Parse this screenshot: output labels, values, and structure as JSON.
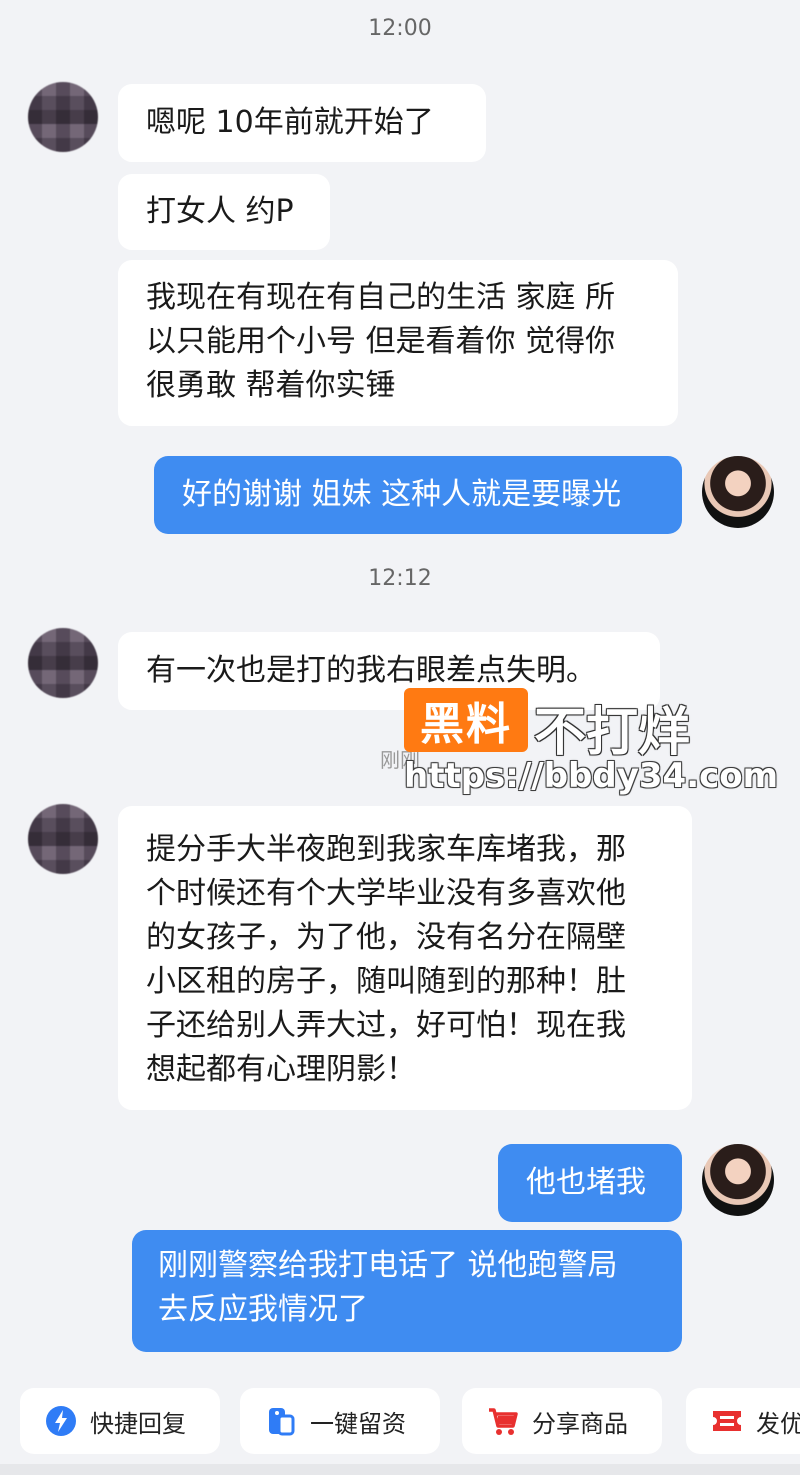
{
  "timestamps": [
    "12:00",
    "12:12",
    "刚刚"
  ],
  "messages": [
    {
      "side": "in",
      "text": "嗯呢 10年前就开始了"
    },
    {
      "side": "in",
      "text": "打女人 约P"
    },
    {
      "side": "in",
      "lines": [
        "我现在有现在有自己的生活 家庭 所",
        "以只能用个小号 但是看着你 觉得你",
        "很勇敢 帮着你实锤"
      ]
    },
    {
      "side": "out",
      "text": "好的谢谢 姐妹 这种人就是要曝光"
    },
    {
      "side": "in",
      "text": "有一次也是打的我右眼差点失明。"
    },
    {
      "side": "in",
      "lines": [
        "提分手大半夜跑到我家车库堵我，那",
        "个时候还有个大学毕业没有多喜欢他",
        "的女孩子，为了他，没有名分在隔壁",
        "小区租的房子，随叫随到的那种！肚",
        "子还给别人弄大过，好可怕！现在我",
        "想起都有心理阴影！"
      ]
    },
    {
      "side": "out",
      "text": "他也堵我"
    },
    {
      "side": "out",
      "lines": [
        "刚刚警察给我打电话了 说他跑警局",
        "去反应我情况了"
      ]
    }
  ],
  "watermark": {
    "brand_box": "黑料",
    "brand_text": "不打烊",
    "url": "https://bbdy34.com"
  },
  "toolbar": {
    "items": [
      {
        "label": "快捷回复",
        "icon": "lightning-icon"
      },
      {
        "label": "一键留资",
        "icon": "form-icon"
      },
      {
        "label": "分享商品",
        "icon": "cart-icon"
      },
      {
        "label": "发优",
        "icon": "coupon-icon"
      }
    ]
  },
  "colors": {
    "accent_blue": "#3f8cf1",
    "background": "#f2f3f6",
    "watermark_orange": "#ff7a12",
    "cart_red": "#e8302f"
  }
}
